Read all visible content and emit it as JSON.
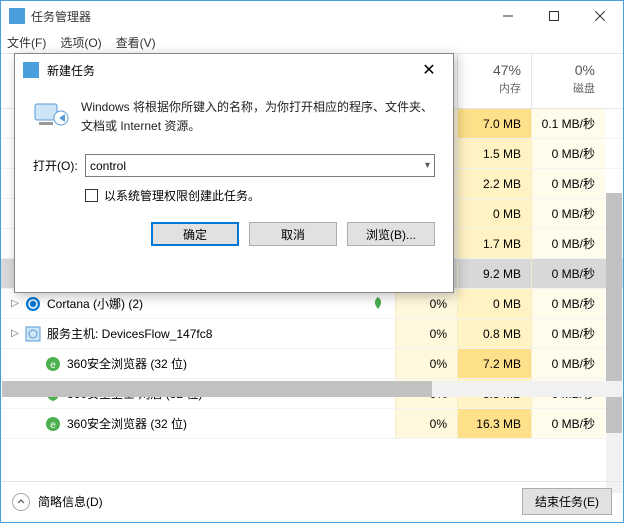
{
  "window": {
    "title": "任务管理器",
    "menu": {
      "file": "文件(F)",
      "options": "选项(O)",
      "view": "查看(V)"
    }
  },
  "columns": {
    "cpu": {
      "pct": "",
      "label": ""
    },
    "mem": {
      "pct": "47%",
      "label": "内存"
    },
    "disk": {
      "pct": "0%",
      "label": "磁盘"
    }
  },
  "rows": [
    {
      "expand": "",
      "name": "",
      "cpu": "",
      "mem": "7.0 MB",
      "disk": "0.1 MB/秒",
      "memhot": true
    },
    {
      "expand": "",
      "name": "",
      "cpu": "",
      "mem": "1.5 MB",
      "disk": "0 MB/秒",
      "memhot": false
    },
    {
      "expand": "",
      "name": "",
      "cpu": "",
      "mem": "2.2 MB",
      "disk": "0 MB/秒",
      "memhot": false
    },
    {
      "expand": "",
      "name": "",
      "cpu": "",
      "mem": "0 MB",
      "disk": "0 MB/秒",
      "memhot": false
    },
    {
      "expand": "",
      "name": "",
      "cpu": "",
      "mem": "1.7 MB",
      "disk": "0 MB/秒",
      "memhot": false
    },
    {
      "expand": "",
      "name": "",
      "cpu": "",
      "mem": "9.2 MB",
      "disk": "0 MB/秒",
      "selected": true
    },
    {
      "expand": "▷",
      "name": "Cortana (小娜) (2)",
      "cpu": "0%",
      "mem": "0 MB",
      "disk": "0 MB/秒",
      "icon": "cortana",
      "leaf": true
    },
    {
      "expand": "▷",
      "name": "服务主机: DevicesFlow_147fc8",
      "cpu": "0%",
      "mem": "0.8 MB",
      "disk": "0 MB/秒",
      "icon": "service"
    },
    {
      "expand": "",
      "name": "360安全浏览器 (32 位)",
      "cpu": "0%",
      "mem": "7.2 MB",
      "disk": "0 MB/秒",
      "icon": "360b",
      "indent": true,
      "memhot": true
    },
    {
      "expand": "",
      "name": "360安全卫士 网盾 (32 位)",
      "cpu": "0%",
      "mem": "5.5 MB",
      "disk": "0 MB/秒",
      "icon": "360s",
      "indent": true
    },
    {
      "expand": "",
      "name": "360安全浏览器 (32 位)",
      "cpu": "0%",
      "mem": "16.3 MB",
      "disk": "0 MB/秒",
      "icon": "360b",
      "indent": true,
      "memhot": true
    }
  ],
  "footer": {
    "brief": "简略信息(D)",
    "endtask": "结束任务(E)"
  },
  "dialog": {
    "title": "新建任务",
    "description": "Windows 将根据你所键入的名称，为你打开相应的程序、文件夹、文档或 Internet 资源。",
    "open_label": "打开(O):",
    "value": "control",
    "admin_label": "以系统管理权限创建此任务。",
    "ok": "确定",
    "cancel": "取消",
    "browse": "浏览(B)..."
  }
}
